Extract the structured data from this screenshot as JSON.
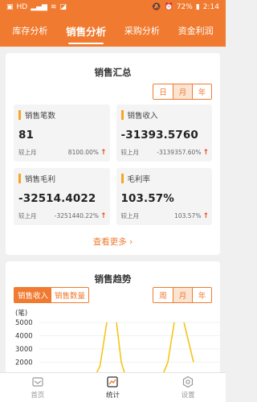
{
  "status_bar": {
    "left_icons": [
      "app-icon",
      "hd-icon",
      "signal-icon",
      "wifi-icon",
      "notification-icon"
    ],
    "battery": "72%",
    "time": "2:14"
  },
  "top_tabs": [
    "库存分析",
    "销售分析",
    "采购分析",
    "资金利润"
  ],
  "summary": {
    "title": "销售汇总",
    "periods": [
      "日",
      "月",
      "年"
    ],
    "active_period": "月",
    "cards": [
      {
        "label": "销售笔数",
        "value": "81",
        "compare_label": "较上月",
        "change": "8100.00%"
      },
      {
        "label": "销售收入",
        "value": "-31393.5760",
        "compare_label": "较上月",
        "change": "-3139357.60%"
      },
      {
        "label": "销售毛利",
        "value": "-32514.4022",
        "compare_label": "较上月",
        "change": "-3251440.22%"
      },
      {
        "label": "毛利率",
        "value": "103.57%",
        "compare_label": "较上月",
        "change": "103.57%"
      }
    ],
    "more_label": "查看更多"
  },
  "trend": {
    "title": "销售趋势",
    "metric_tabs": [
      "销售收入",
      "销售数量"
    ],
    "active_metric": "销售收入",
    "periods": [
      "周",
      "月",
      "年"
    ],
    "active_period": "月",
    "unit_label": "(笔)",
    "accent_line": "#f5c518"
  },
  "chart_data": {
    "type": "line",
    "ylabel": "(笔)",
    "yticks": [
      5000,
      4000,
      3000,
      2000,
      1000
    ],
    "series": [
      {
        "values": [
          0,
          200,
          700,
          1700,
          5000
        ]
      },
      {
        "values": [
          5000,
          2000,
          800
        ]
      },
      {
        "values": [
          800,
          2000,
          5000
        ]
      },
      {
        "values": [
          5000,
          2000
        ]
      }
    ]
  },
  "bottom_nav": [
    {
      "label": "首页",
      "icon": "home-icon"
    },
    {
      "label": "统计",
      "icon": "stats-icon"
    },
    {
      "label": "设置",
      "icon": "settings-icon"
    }
  ],
  "colors": {
    "brand": "#f07a2f",
    "card_bar": "#f5a623",
    "arrow_up": "#e8491d"
  }
}
